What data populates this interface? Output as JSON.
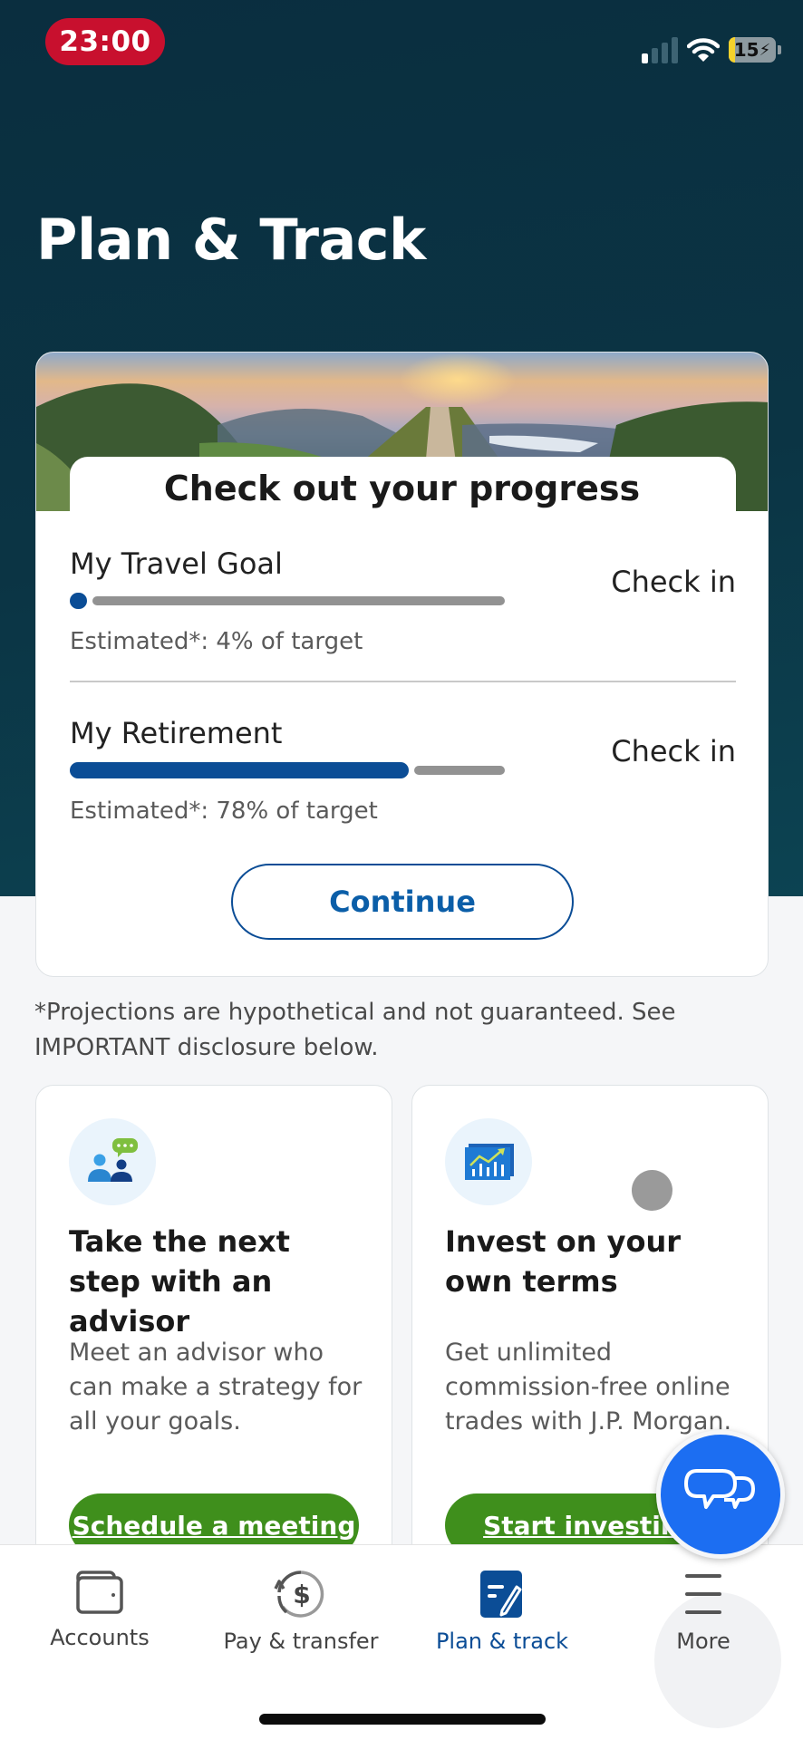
{
  "status_bar": {
    "time": "23:00",
    "battery_level": "15",
    "icons": [
      "signal-icon",
      "wifi-icon",
      "battery-charging-icon"
    ]
  },
  "header": {
    "title": "Plan & Track"
  },
  "progress_card": {
    "heading": "Check out your progress",
    "goals": [
      {
        "name": "My Travel Goal",
        "action": "Check in",
        "estimate": "Estimated*: 4% of target",
        "percent": 4
      },
      {
        "name": "My Retirement",
        "action": "Check in",
        "estimate": "Estimated*: 78% of target",
        "percent": 78
      }
    ],
    "continue_label": "Continue"
  },
  "disclaimer": "*Projections are hypothetical and not guaranteed. See IMPORTANT disclosure below.",
  "promos": [
    {
      "icon": "advisor-chat-icon",
      "title": "Take the next step with an advisor",
      "description": "Meet an advisor who can make a strategy for all your goals.",
      "button": "Schedule a meeting"
    },
    {
      "icon": "investing-chart-icon",
      "title": "Invest on your own terms",
      "description": "Get unlimited commission-free online trades with J.P. Morgan.",
      "button": "Start investing"
    }
  ],
  "chat_button": {
    "icon": "chat-bubbles-icon"
  },
  "bottom_nav": {
    "items": [
      {
        "label": "Accounts",
        "icon": "wallet-icon",
        "active": false
      },
      {
        "label": "Pay & transfer",
        "icon": "dollar-transfer-icon",
        "active": false
      },
      {
        "label": "Plan & track",
        "icon": "plan-track-icon",
        "active": true
      },
      {
        "label": "More",
        "icon": "menu-icon",
        "active": false
      }
    ]
  },
  "colors": {
    "header_bg": "#0b3444",
    "primary_blue": "#0b4d96",
    "cta_green": "#3f8f1c",
    "chat_blue": "#1c6ef2",
    "time_badge": "#c8102e"
  }
}
